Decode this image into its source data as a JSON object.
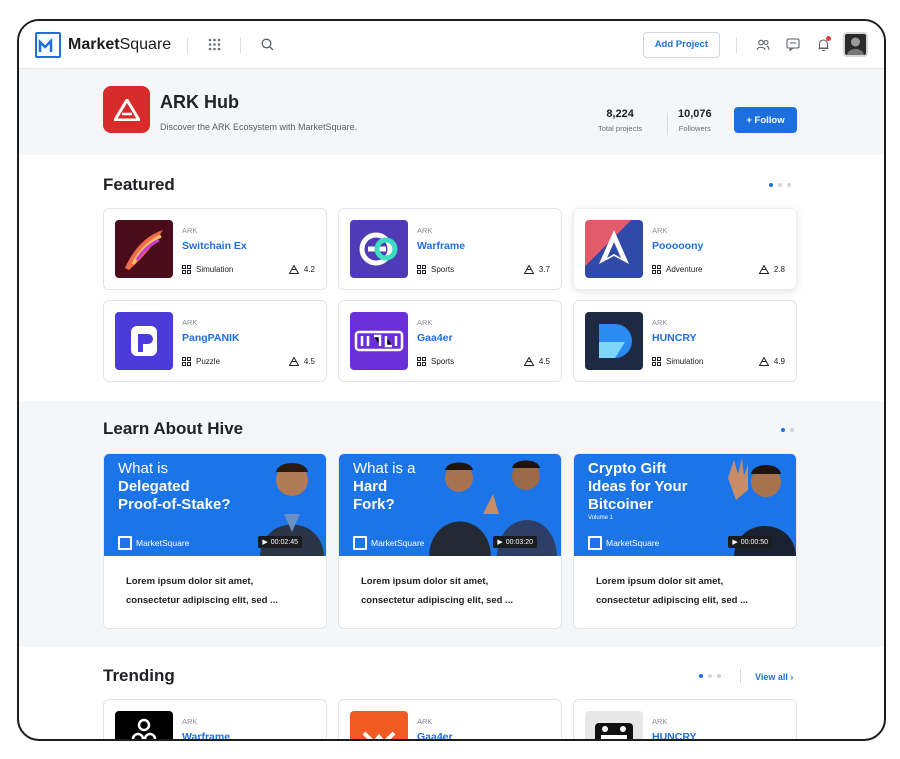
{
  "topbar": {
    "brand_bold": "Market",
    "brand_rest": "Square",
    "add_project": "Add Project",
    "icons": [
      "grid-icon",
      "search-icon",
      "people-icon",
      "chat-icon",
      "bell-icon"
    ]
  },
  "hub": {
    "title": "ARK Hub",
    "description": "Discover the ARK Ecosystem with MarketSquare.",
    "projects_value": "8,224",
    "projects_label": "Total projects",
    "followers_value": "10,076",
    "followers_label": "Followers",
    "follow_label": "+ Follow"
  },
  "featured": {
    "title": "Featured",
    "cards": [
      {
        "org": "ARK",
        "name": "Switchain Ex",
        "genre": "Simulation",
        "rating": "4.2"
      },
      {
        "org": "ARK",
        "name": "Warframe",
        "genre": "Sports",
        "rating": "3.7"
      },
      {
        "org": "ARK",
        "name": "Pooooony",
        "genre": "Adventure",
        "rating": "2.8"
      },
      {
        "org": "ARK",
        "name": "PangPANIK",
        "genre": "Puzzle",
        "rating": "4.5"
      },
      {
        "org": "ARK",
        "name": "Gaa4er",
        "genre": "Sports",
        "rating": "4.5"
      },
      {
        "org": "ARK",
        "name": "HUNCRY",
        "genre": "Simulation",
        "rating": "4.9"
      }
    ]
  },
  "learn": {
    "title": "Learn About Hive",
    "videos": [
      {
        "line1": "What is",
        "line2": "Delegated",
        "line3": "Proof-of-Stake?",
        "duration": "00:02:45",
        "brand": "MarketSquare",
        "text1": "Lorem ipsum dolor sit amet,",
        "text2": "consectetur adipiscing elit, sed ..."
      },
      {
        "line1": "What is a",
        "line2": "Hard",
        "line3": "Fork?",
        "duration": "00:03:20",
        "brand": "MarketSquare",
        "text1": "Lorem ipsum dolor sit amet,",
        "text2": "consectetur adipiscing elit, sed ..."
      },
      {
        "line1": "Crypto Gift",
        "line2": "Ideas for Your",
        "line3": "Bitcoiner",
        "sub": "Volume 1",
        "duration": "00:00:50",
        "brand": "MarketSquare",
        "text1": "Lorem ipsum dolor sit amet,",
        "text2": "consectetur adipiscing elit, sed ..."
      }
    ]
  },
  "trending": {
    "title": "Trending",
    "view_all": "View all",
    "cards": [
      {
        "org": "ARK",
        "name": "Warframe"
      },
      {
        "org": "ARK",
        "name": "Gaa4er"
      },
      {
        "org": "ARK",
        "name": "HUNCRY"
      }
    ]
  },
  "colors": {
    "accent": "#1d6fe0",
    "hub_red": "#d82c2c",
    "bg_soft": "#f4f6f8"
  }
}
